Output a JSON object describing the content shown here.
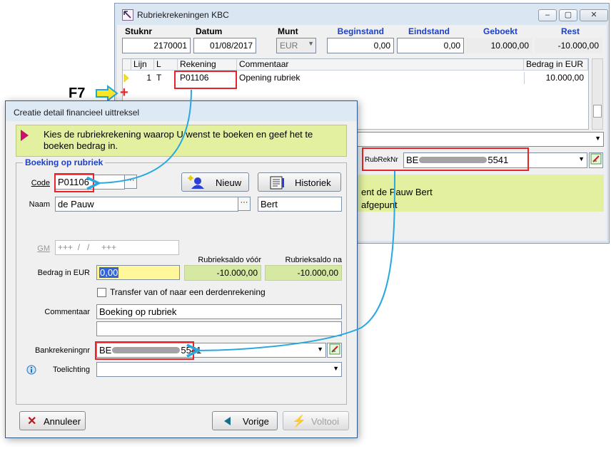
{
  "main_window": {
    "title": "Rubriekrekeningen KBC",
    "controls": {
      "minimize": "–",
      "maximize": "▢",
      "close": "✕"
    },
    "headers": {
      "stuknr": "Stuknr",
      "datum": "Datum",
      "munt": "Munt",
      "beginstand": "Beginstand",
      "eindstand": "Eindstand",
      "geboekt": "Geboekt",
      "rest": "Rest"
    },
    "values": {
      "stuknr": "2170001",
      "datum": "01/08/2017",
      "munt": "EUR",
      "beginstand": "0,00",
      "eindstand": "0,00",
      "geboekt": "10.000,00",
      "rest": "-10.000,00"
    },
    "grid": {
      "columns": [
        "Lijn",
        "L",
        "Rekening",
        "Commentaar",
        "Bedrag in EUR"
      ],
      "rows": [
        {
          "lijn": "1",
          "l": "T",
          "rekening": "P01106",
          "commentaar": "Opening rubriek",
          "bedrag": "10.000,00"
        }
      ]
    },
    "rubreknr_label": "RubRekNr",
    "rubreknr_start": "BE",
    "rubreknr_end": "5541",
    "info_line1": "ent de Pauw Bert",
    "info_line2": "afgepunt"
  },
  "annotation": {
    "key": "F7",
    "plus": "+"
  },
  "dialog": {
    "title": "Creatie detail financieel uittreksel",
    "hint": "Kies de rubriekrekening waarop U wenst te boeken en geef het te boeken bedrag in.",
    "group_title": "Boeking op rubriek",
    "code_label": "Code",
    "code_value": "P01106",
    "new_button": "Nieuw",
    "history_button": "Historiek",
    "naam_label": "Naam",
    "naam_value": "de Pauw",
    "first_name": "Bert",
    "gm_label": "GM",
    "gm_value": "+++  /   /     +++",
    "saldo_voor_label": "Rubrieksaldo vóór",
    "saldo_na_label": "Rubrieksaldo na",
    "bedrag_label": "Bedrag in EUR",
    "bedrag_value": "0,00",
    "saldo_voor": "-10.000,00",
    "saldo_na": "-10.000,00",
    "transfer_label": "Transfer van of naar een derdenrekening",
    "commentaar_label": "Commentaar",
    "commentaar_value": "Boeking op rubriek",
    "bank_label": "Bankrekeningnr",
    "bank_start": "BE",
    "bank_end": "5541",
    "toelichting_label": "Toelichting",
    "cancel_button": "Annuleer",
    "prev_button": "Vorige",
    "finish_button": "Voltooi"
  },
  "colors": {
    "accent_blue": "#1c3fc6",
    "hint_green": "#e2f0a0",
    "highlight_red": "#e5252a",
    "connector_blue": "#29a8e0",
    "hint_arrow": "#c8106c"
  }
}
